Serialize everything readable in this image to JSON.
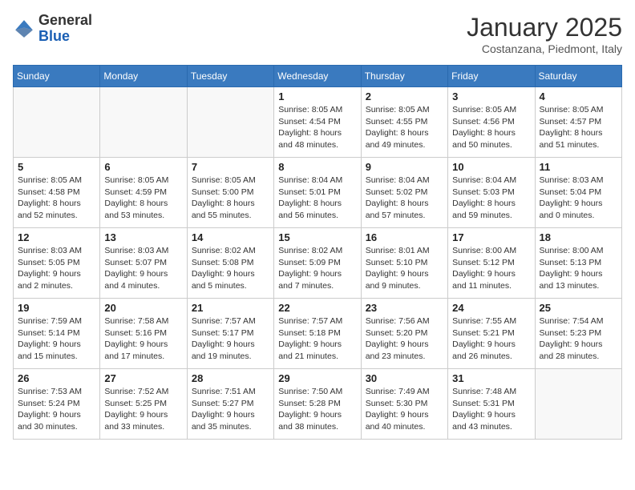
{
  "header": {
    "logo_general": "General",
    "logo_blue": "Blue",
    "month_title": "January 2025",
    "subtitle": "Costanzana, Piedmont, Italy"
  },
  "days_of_week": [
    "Sunday",
    "Monday",
    "Tuesday",
    "Wednesday",
    "Thursday",
    "Friday",
    "Saturday"
  ],
  "weeks": [
    [
      {
        "day": "",
        "info": ""
      },
      {
        "day": "",
        "info": ""
      },
      {
        "day": "",
        "info": ""
      },
      {
        "day": "1",
        "info": "Sunrise: 8:05 AM\nSunset: 4:54 PM\nDaylight: 8 hours\nand 48 minutes."
      },
      {
        "day": "2",
        "info": "Sunrise: 8:05 AM\nSunset: 4:55 PM\nDaylight: 8 hours\nand 49 minutes."
      },
      {
        "day": "3",
        "info": "Sunrise: 8:05 AM\nSunset: 4:56 PM\nDaylight: 8 hours\nand 50 minutes."
      },
      {
        "day": "4",
        "info": "Sunrise: 8:05 AM\nSunset: 4:57 PM\nDaylight: 8 hours\nand 51 minutes."
      }
    ],
    [
      {
        "day": "5",
        "info": "Sunrise: 8:05 AM\nSunset: 4:58 PM\nDaylight: 8 hours\nand 52 minutes."
      },
      {
        "day": "6",
        "info": "Sunrise: 8:05 AM\nSunset: 4:59 PM\nDaylight: 8 hours\nand 53 minutes."
      },
      {
        "day": "7",
        "info": "Sunrise: 8:05 AM\nSunset: 5:00 PM\nDaylight: 8 hours\nand 55 minutes."
      },
      {
        "day": "8",
        "info": "Sunrise: 8:04 AM\nSunset: 5:01 PM\nDaylight: 8 hours\nand 56 minutes."
      },
      {
        "day": "9",
        "info": "Sunrise: 8:04 AM\nSunset: 5:02 PM\nDaylight: 8 hours\nand 57 minutes."
      },
      {
        "day": "10",
        "info": "Sunrise: 8:04 AM\nSunset: 5:03 PM\nDaylight: 8 hours\nand 59 minutes."
      },
      {
        "day": "11",
        "info": "Sunrise: 8:03 AM\nSunset: 5:04 PM\nDaylight: 9 hours\nand 0 minutes."
      }
    ],
    [
      {
        "day": "12",
        "info": "Sunrise: 8:03 AM\nSunset: 5:05 PM\nDaylight: 9 hours\nand 2 minutes."
      },
      {
        "day": "13",
        "info": "Sunrise: 8:03 AM\nSunset: 5:07 PM\nDaylight: 9 hours\nand 4 minutes."
      },
      {
        "day": "14",
        "info": "Sunrise: 8:02 AM\nSunset: 5:08 PM\nDaylight: 9 hours\nand 5 minutes."
      },
      {
        "day": "15",
        "info": "Sunrise: 8:02 AM\nSunset: 5:09 PM\nDaylight: 9 hours\nand 7 minutes."
      },
      {
        "day": "16",
        "info": "Sunrise: 8:01 AM\nSunset: 5:10 PM\nDaylight: 9 hours\nand 9 minutes."
      },
      {
        "day": "17",
        "info": "Sunrise: 8:00 AM\nSunset: 5:12 PM\nDaylight: 9 hours\nand 11 minutes."
      },
      {
        "day": "18",
        "info": "Sunrise: 8:00 AM\nSunset: 5:13 PM\nDaylight: 9 hours\nand 13 minutes."
      }
    ],
    [
      {
        "day": "19",
        "info": "Sunrise: 7:59 AM\nSunset: 5:14 PM\nDaylight: 9 hours\nand 15 minutes."
      },
      {
        "day": "20",
        "info": "Sunrise: 7:58 AM\nSunset: 5:16 PM\nDaylight: 9 hours\nand 17 minutes."
      },
      {
        "day": "21",
        "info": "Sunrise: 7:57 AM\nSunset: 5:17 PM\nDaylight: 9 hours\nand 19 minutes."
      },
      {
        "day": "22",
        "info": "Sunrise: 7:57 AM\nSunset: 5:18 PM\nDaylight: 9 hours\nand 21 minutes."
      },
      {
        "day": "23",
        "info": "Sunrise: 7:56 AM\nSunset: 5:20 PM\nDaylight: 9 hours\nand 23 minutes."
      },
      {
        "day": "24",
        "info": "Sunrise: 7:55 AM\nSunset: 5:21 PM\nDaylight: 9 hours\nand 26 minutes."
      },
      {
        "day": "25",
        "info": "Sunrise: 7:54 AM\nSunset: 5:23 PM\nDaylight: 9 hours\nand 28 minutes."
      }
    ],
    [
      {
        "day": "26",
        "info": "Sunrise: 7:53 AM\nSunset: 5:24 PM\nDaylight: 9 hours\nand 30 minutes."
      },
      {
        "day": "27",
        "info": "Sunrise: 7:52 AM\nSunset: 5:25 PM\nDaylight: 9 hours\nand 33 minutes."
      },
      {
        "day": "28",
        "info": "Sunrise: 7:51 AM\nSunset: 5:27 PM\nDaylight: 9 hours\nand 35 minutes."
      },
      {
        "day": "29",
        "info": "Sunrise: 7:50 AM\nSunset: 5:28 PM\nDaylight: 9 hours\nand 38 minutes."
      },
      {
        "day": "30",
        "info": "Sunrise: 7:49 AM\nSunset: 5:30 PM\nDaylight: 9 hours\nand 40 minutes."
      },
      {
        "day": "31",
        "info": "Sunrise: 7:48 AM\nSunset: 5:31 PM\nDaylight: 9 hours\nand 43 minutes."
      },
      {
        "day": "",
        "info": ""
      }
    ]
  ]
}
